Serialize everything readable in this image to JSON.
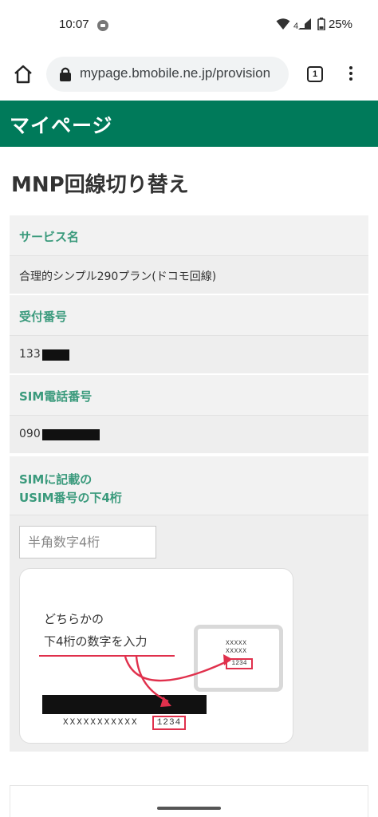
{
  "status_bar": {
    "time": "10:07",
    "battery": "25%",
    "icons": [
      "line-app-icon",
      "wifi-icon",
      "signal-icon",
      "battery-icon"
    ]
  },
  "browser": {
    "url": "mypage.bmobile.ne.jp/provision",
    "tab_count": "1",
    "icons": [
      "home-icon",
      "lock-icon",
      "menu-icon"
    ]
  },
  "site": {
    "header_title": "マイページ"
  },
  "page": {
    "title": "MNP回線切り替え",
    "fields": [
      {
        "label": "サービス名",
        "value": "合理的シンプル290プラン(ドコモ回線)"
      },
      {
        "label": "受付番号",
        "value": "133"
      },
      {
        "label": "SIM電話番号",
        "value": "090"
      }
    ],
    "usim": {
      "label_line1": "SIMに記載の",
      "label_line2": "USIM番号の下4桁",
      "placeholder": "半角数字4桁"
    },
    "guide": {
      "line1": "どちらかの",
      "line2": "下4桁の数字を入力",
      "sim_x1": "XXXXX",
      "sim_x2": "XXXXX",
      "sim_code": "1234",
      "bar_x": "XXXXXXXXXXX",
      "bar_code": "1234"
    }
  },
  "colors": {
    "header_bg": "#007a5a",
    "label_green": "#3a9a7c",
    "highlight_red": "#e0304c"
  }
}
